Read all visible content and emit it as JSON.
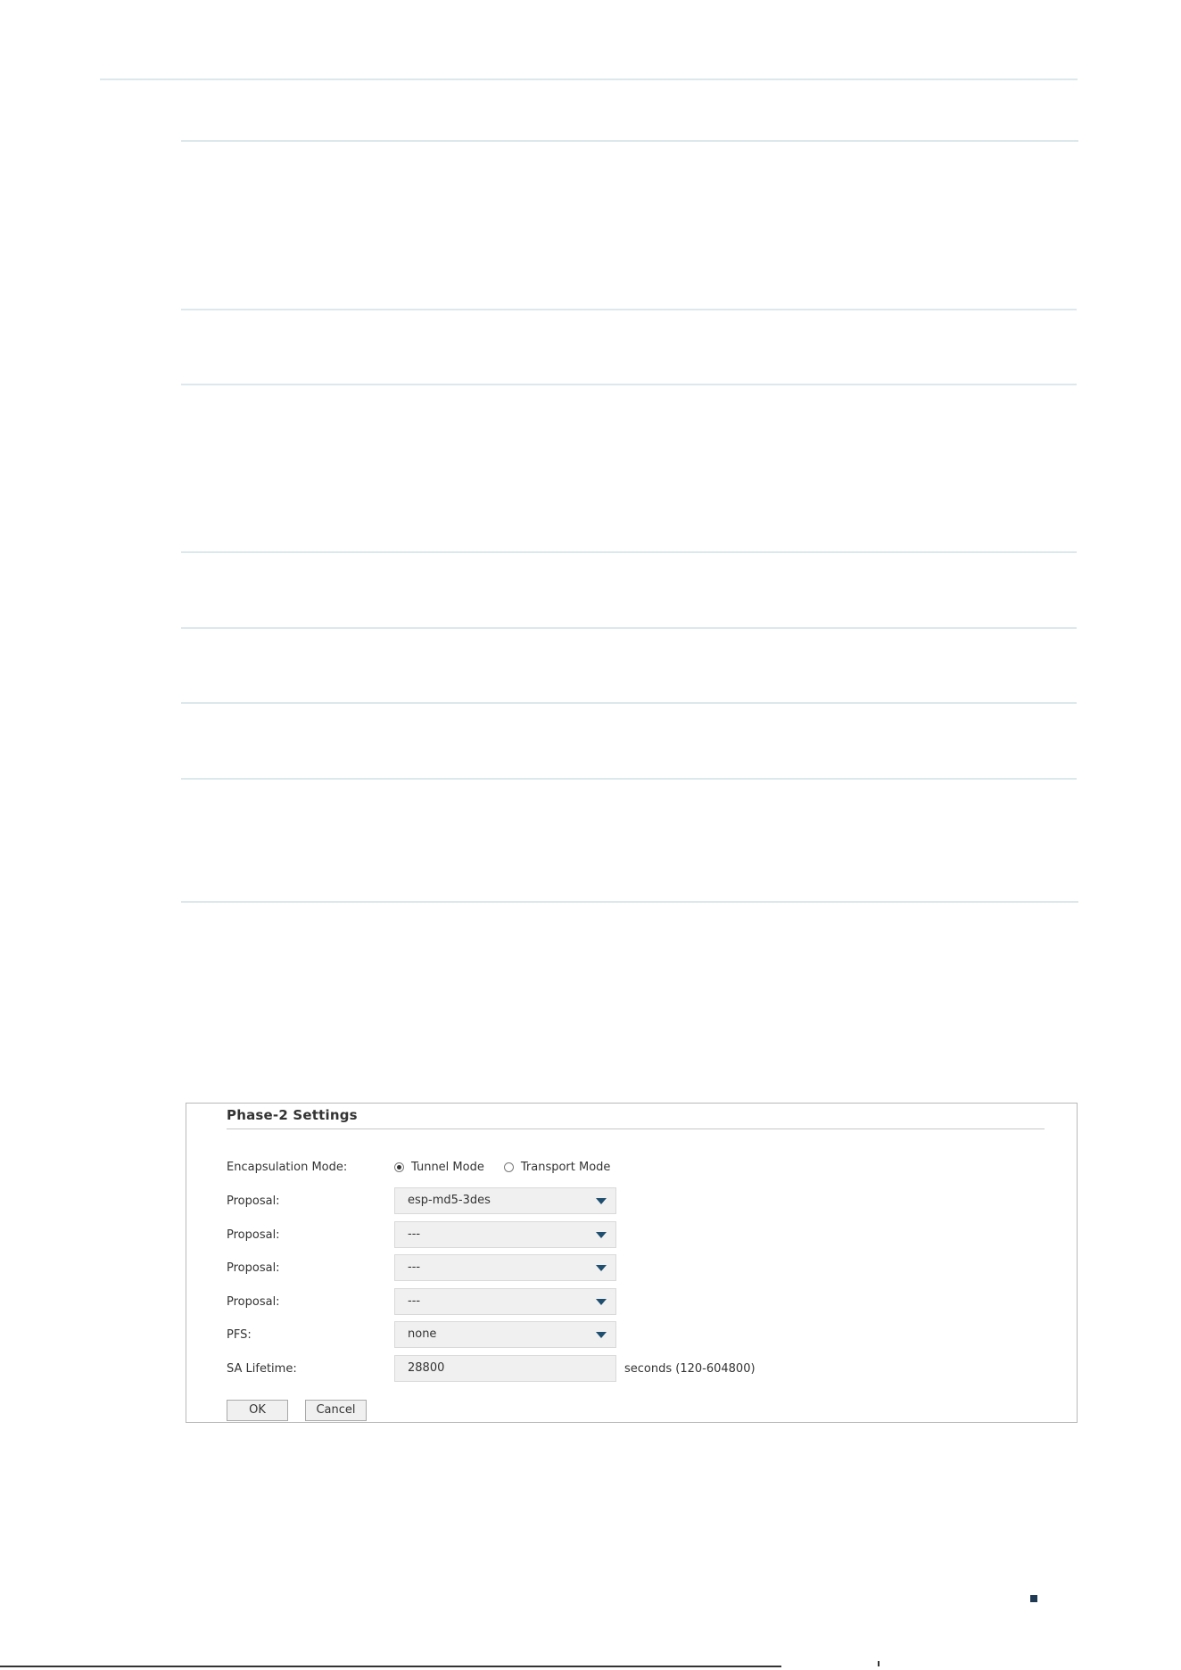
{
  "panel": {
    "title": "Phase-2 Settings",
    "encapsulation": {
      "label": "Encapsulation Mode:",
      "options": [
        {
          "label": "Tunnel Mode",
          "checked": true
        },
        {
          "label": "Transport Mode",
          "checked": false
        }
      ]
    },
    "proposals": [
      {
        "label": "Proposal:",
        "value": "esp-md5-3des"
      },
      {
        "label": "Proposal:",
        "value": "---"
      },
      {
        "label": "Proposal:",
        "value": "---"
      },
      {
        "label": "Proposal:",
        "value": "---"
      }
    ],
    "pfs": {
      "label": "PFS:",
      "value": "none"
    },
    "sa_lifetime": {
      "label": "SA Lifetime:",
      "value": "28800",
      "hint": "seconds (120-604800)"
    },
    "buttons": {
      "ok": "OK",
      "cancel": "Cancel"
    }
  },
  "icons": {
    "dropdown": "caret-down-icon",
    "radio": "radio-icon"
  },
  "colors": {
    "divider": "#dce8ec",
    "caret": "#1f4e6e",
    "field_bg": "#f0f0f0",
    "page_marker": "#1f3a52"
  }
}
